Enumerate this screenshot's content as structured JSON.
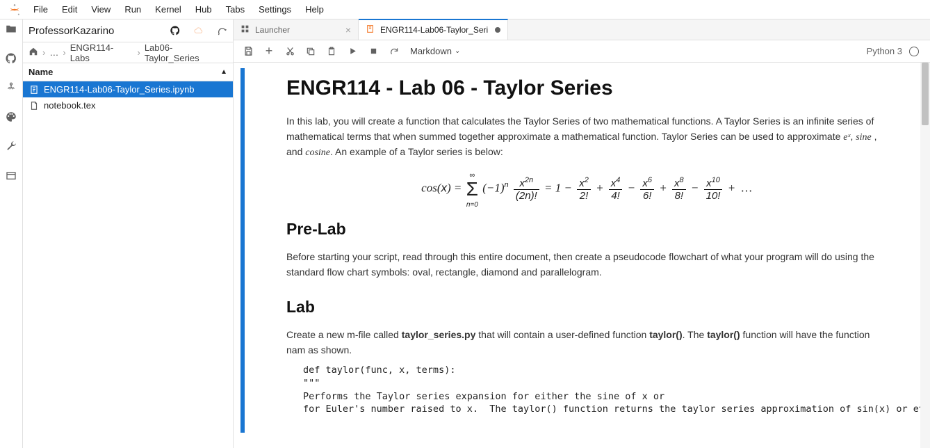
{
  "menu": {
    "items": [
      "File",
      "Edit",
      "View",
      "Run",
      "Kernel",
      "Hub",
      "Tabs",
      "Settings",
      "Help"
    ]
  },
  "sidebar": {
    "title": "ProfessorKazarino",
    "breadcrumb": [
      "…",
      "ENGR114-Labs",
      "Lab06-Taylor_Series"
    ],
    "column_header": "Name",
    "files": [
      {
        "name": "ENGR114-Lab06-Taylor_Series.ipynb",
        "icon": "notebook",
        "selected": true
      },
      {
        "name": "notebook.tex",
        "icon": "file",
        "selected": false
      }
    ]
  },
  "tabs": [
    {
      "label": "Launcher",
      "icon": "launcher",
      "active": false,
      "closable": true
    },
    {
      "label": "ENGR114-Lab06-Taylor_Seri",
      "icon": "notebook",
      "active": true,
      "dirty": true
    }
  ],
  "toolbar": {
    "celltype": "Markdown",
    "kernel": "Python 3"
  },
  "doc": {
    "h1": "ENGR114 - Lab 06 - Taylor Series",
    "p1a": "In this lab, you will create a function that calculates the Taylor Series of two mathematical functions. A Taylor Series is an infinite series of mathematical terms that when summed together approximate a mathematical function. Taylor Series can be used to approximate ",
    "p1b": ", and ",
    "p1c": ". An example of a Taylor series is below:",
    "math_ex": "eˣ",
    "math_sine": "sine",
    "math_cos": "cosine",
    "equation_plain": "cos(x) = Σ_{n=0}^{∞} (−1)^n · x^{2n}/(2n)! = 1 − x²/2! + x⁴/4! − x⁶/6! + x⁸/8! − x¹⁰/10! + …",
    "h2a": "Pre-Lab",
    "p2": "Before starting your script, read through this entire document, then create a pseudocode flowchart of what your program will do using the standard flow chart symbols: oval, rectangle, diamond and parallelogram.",
    "h2b": "Lab",
    "p3a": "Create a new m-file called ",
    "p3b": "taylor_series.py",
    "p3c": " that will contain a user-defined function ",
    "p3d": "taylor()",
    "p3e": ". The ",
    "p3f": "taylor()",
    "p3g": " function will have the function nam as shown.",
    "code": "def taylor(func, x, terms):\n\"\"\"\nPerforms the Taylor series expansion for either the sine of x or\nfor Euler's number raised to x.  The taylor() function returns the taylor series approximation of sin(x) or e^"
  }
}
